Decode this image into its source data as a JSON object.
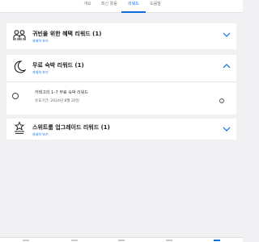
{
  "tabs": [
    {
      "label": "개요"
    },
    {
      "label": "최신 활동"
    },
    {
      "label": "리워드",
      "active": true
    },
    {
      "label": "도움말"
    }
  ],
  "cards": [
    {
      "title": "귀빈을 위한 혜택 리워드 (1)",
      "link": "자세히 보기",
      "icon": "people-icon",
      "expanded": false
    },
    {
      "title": "무료 숙박 리워드 (1)",
      "link": "자세히 보기",
      "icon": "moon-icon",
      "expanded": true,
      "item": {
        "title": "카테고리 1–7 무료 숙박 리워드",
        "date": "유효기간: 2024년 8월 20일"
      }
    },
    {
      "title": "스위트룸 업그레이드 리워드 (1)",
      "link": "자세히 보기",
      "icon": "star-stack-icon",
      "expanded": false
    }
  ],
  "colors": {
    "accent": "#0a6bd6",
    "background": "#f1f1f3"
  }
}
